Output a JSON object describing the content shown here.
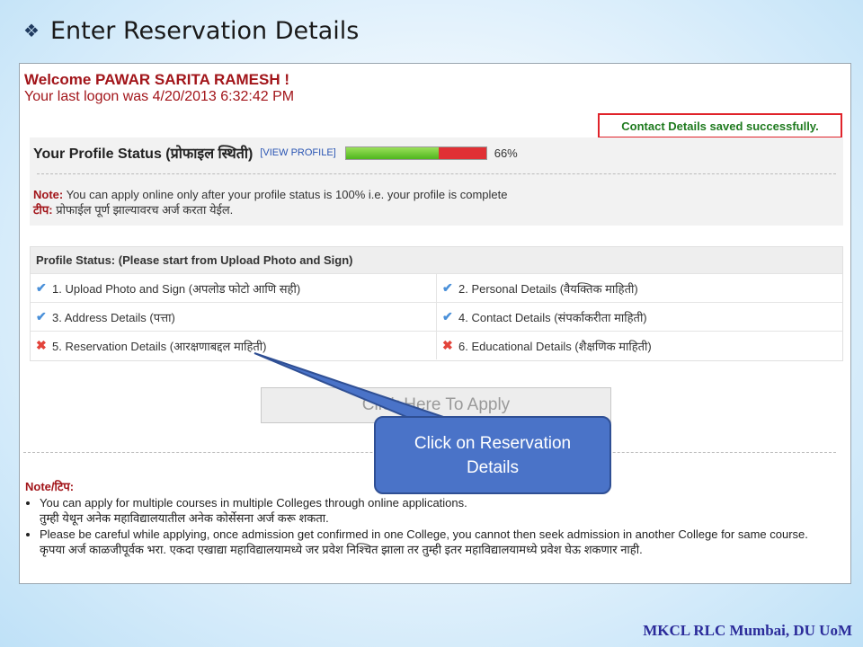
{
  "slide": {
    "title": "Enter Reservation Details",
    "footer": "MKCL RLC Mumbai, DU UoM"
  },
  "welcome": {
    "greeting": "Welcome PAWAR SARITA RAMESH !",
    "last_logon": "Your last logon was 4/20/2013 6:32:42 PM"
  },
  "success_message": "Contact Details saved successfully.",
  "profile": {
    "title": "Your Profile Status (प्रोफाइल स्थिती)",
    "view_link": "[VIEW PROFILE]",
    "progress_percent": 66,
    "progress_label": "66%",
    "note_label": "Note:",
    "note_text": " You can apply online only after your profile status is 100% i.e. your profile is complete",
    "note_marathi_label": "टीप:",
    "note_marathi_text": " प्रोफाईल पूर्ण झाल्यावरच अर्ज करता येईल."
  },
  "status": {
    "header": "Profile Status: (Please start from Upload Photo and Sign)",
    "items": [
      {
        "label": "1. Upload Photo and Sign (अपलोड फोटो आणि सही)",
        "icon": "check-icon",
        "glyph": "✔"
      },
      {
        "label": "2. Personal Details (वैयक्तिक माहिती)",
        "icon": "check-icon",
        "glyph": "✔"
      },
      {
        "label": "3. Address Details (पत्ता)",
        "icon": "check-icon",
        "glyph": "✔"
      },
      {
        "label": "4. Contact Details (संपर्काकरीता माहिती)",
        "icon": "check-icon",
        "glyph": "✔"
      },
      {
        "label": "5. Reservation Details (आरक्षणाबद्दल माहिती)",
        "icon": "cross-icon",
        "glyph": "✖"
      },
      {
        "label": "6. Educational Details (शैक्षणिक माहिती)",
        "icon": "cross-icon",
        "glyph": "✖"
      }
    ]
  },
  "apply_button": "Click Here To Apply",
  "bottom_note": {
    "heading": "Note/टिप:",
    "bullets": [
      {
        "en": "You can apply for multiple courses in multiple Colleges through online applications.",
        "mr": "तुम्ही येथून अनेक महाविद्यालयातील अनेक कोर्सेसना अर्ज करू शकता."
      },
      {
        "en": "Please be careful while applying, once admission get confirmed in one College, you cannot then seek admission in another College for same course.",
        "mr": "कृपया अर्ज काळजीपूर्वक भरा. एकदा एखाद्या महाविद्यालयामध्ये जर प्रवेश निश्चित झाला तर तुम्ही इतर महाविद्यालयामध्ये प्रवेश घेऊ शकणार नाही."
      }
    ]
  },
  "callout": "Click on Reservation Details",
  "colors": {
    "accent_red": "#a2151a",
    "success_green": "#1e7a1e",
    "callout_blue": "#4a73c8",
    "check_blue": "#4a90d9",
    "cross_red": "#e3443b"
  }
}
